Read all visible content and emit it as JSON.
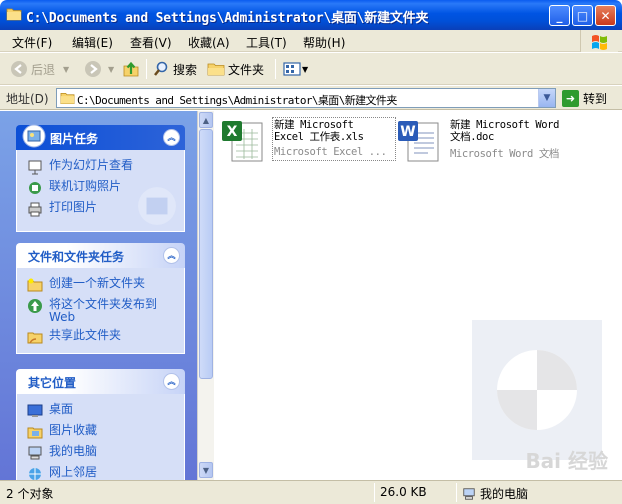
{
  "window": {
    "title": "C:\\Documents and Settings\\Administrator\\桌面\\新建文件夹",
    "minimize": "_",
    "maximize": "□",
    "close": "✕"
  },
  "menu": [
    {
      "label": "文件(F)"
    },
    {
      "label": "编辑(E)"
    },
    {
      "label": "查看(V)"
    },
    {
      "label": "收藏(A)"
    },
    {
      "label": "工具(T)"
    },
    {
      "label": "帮助(H)"
    }
  ],
  "toolbar": {
    "back_label": "后退",
    "search_label": "搜索",
    "folders_label": "文件夹"
  },
  "address": {
    "label": "地址(D)",
    "value": "C:\\Documents and Settings\\Administrator\\桌面\\新建文件夹",
    "go_label": "转到"
  },
  "panels": {
    "picture_tasks": {
      "title": "图片任务",
      "items": [
        {
          "label": "作为幻灯片查看"
        },
        {
          "label": "联机订购照片"
        },
        {
          "label": "打印图片"
        }
      ]
    },
    "file_tasks": {
      "title": "文件和文件夹任务",
      "items": [
        {
          "label": "创建一个新文件夹"
        },
        {
          "label": "将这个文件夹发布到",
          "label2": "Web"
        },
        {
          "label": "共享此文件夹"
        }
      ]
    },
    "other_places": {
      "title": "其它位置",
      "items": [
        {
          "label": "桌面"
        },
        {
          "label": "图片收藏"
        },
        {
          "label": "我的电脑"
        },
        {
          "label": "网上邻居"
        }
      ]
    }
  },
  "files": [
    {
      "line1": "新建 Microsoft",
      "line2": "Excel 工作表.xls",
      "type": "Microsoft Excel ...",
      "icon": "excel-icon"
    },
    {
      "line1": "新建 Microsoft Word",
      "line2": "文档.doc",
      "type": "Microsoft Word 文档",
      "icon": "word-icon"
    }
  ],
  "status": {
    "count": "2 个对象",
    "size": "26.0 KB",
    "location": "我的电脑"
  },
  "watermark_text": "Bai 经验",
  "colors": {
    "title_blue": "#0054e3",
    "task_link": "#215dc6",
    "pane_bg": "#7ba2e7"
  }
}
